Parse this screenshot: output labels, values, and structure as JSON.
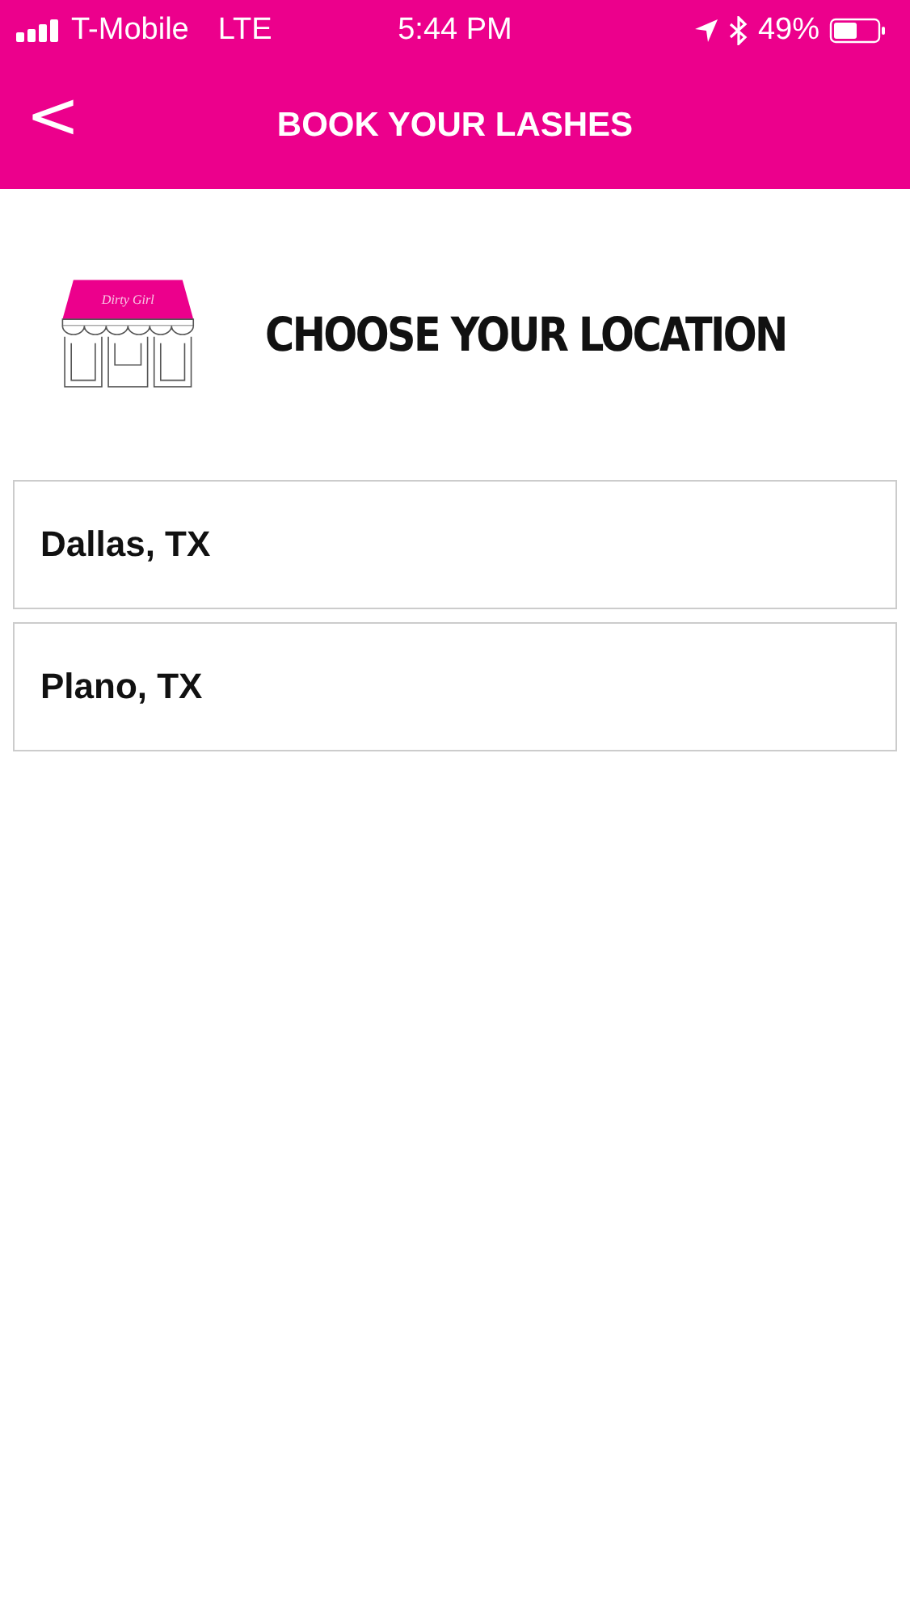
{
  "status_bar": {
    "carrier": "T-Mobile",
    "network": "LTE",
    "time": "5:44 PM",
    "battery": "49%"
  },
  "nav_bar": {
    "back": "<",
    "title": "BOOK YOUR LASHES"
  },
  "header": {
    "logo_text": "Dirty Girl",
    "heading": "CHOOSE YOUR LOCATION"
  },
  "locations": [
    {
      "name": "Dallas, TX"
    },
    {
      "name": "Plano, TX"
    }
  ]
}
